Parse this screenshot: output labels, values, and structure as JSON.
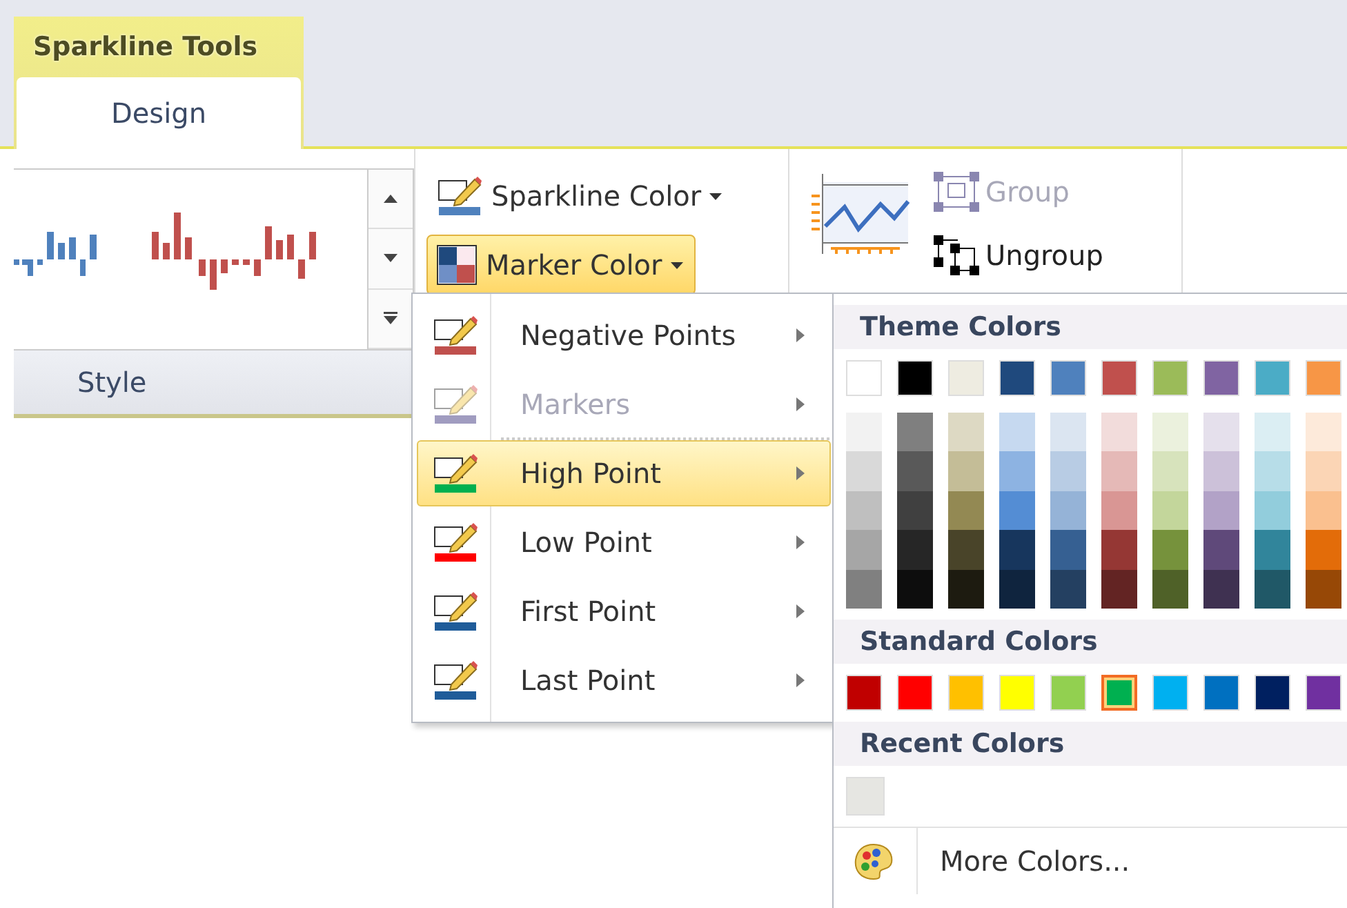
{
  "contextual_tab": {
    "title": "Sparkline Tools"
  },
  "tabs": [
    {
      "label": "Design",
      "selected": true
    }
  ],
  "ribbon": {
    "style_group": {
      "label": "Style"
    },
    "show_group": [
      {
        "label": "Sparkline Color",
        "kind": "pen",
        "color": "#4f81bd",
        "selected": false
      },
      {
        "label": "Marker Color",
        "kind": "marker",
        "color": "#c0504d",
        "selected": true
      }
    ],
    "group_buttons": [
      {
        "label": "Group",
        "kind": "group",
        "disabled": true
      },
      {
        "label": "Ungroup",
        "kind": "ungroup",
        "disabled": false
      }
    ]
  },
  "marker_menu": {
    "items": [
      {
        "label": "Negative Points",
        "color": "#c0504d",
        "disabled": false,
        "selected": false
      },
      {
        "label": "Markers",
        "color": "#a09cc0",
        "disabled": true,
        "selected": false
      },
      {
        "label": "High Point",
        "color": "#00b050",
        "disabled": false,
        "selected": true
      },
      {
        "label": "Low Point",
        "color": "#ff0000",
        "disabled": false,
        "selected": false
      },
      {
        "label": "First Point",
        "color": "#1f5c99",
        "disabled": false,
        "selected": false
      },
      {
        "label": "Last Point",
        "color": "#1f5c99",
        "disabled": false,
        "selected": false
      }
    ]
  },
  "color_panel": {
    "theme_title": "Theme Colors",
    "theme_colors": [
      {
        "color": "#ffffff",
        "shades": [
          {
            "color": "#f2f2f2"
          },
          {
            "color": "#d9d9d9"
          },
          {
            "color": "#bfbfbf"
          },
          {
            "color": "#a6a6a6"
          },
          {
            "color": "#808080"
          }
        ]
      },
      {
        "color": "#000000",
        "shades": [
          {
            "color": "#7f7f7f"
          },
          {
            "color": "#595959"
          },
          {
            "color": "#404040"
          },
          {
            "color": "#262626"
          },
          {
            "color": "#0d0d0d"
          }
        ]
      },
      {
        "color": "#eeece1",
        "shades": [
          {
            "color": "#ddd9c3"
          },
          {
            "color": "#c4bd97"
          },
          {
            "color": "#938953"
          },
          {
            "color": "#494429"
          },
          {
            "color": "#1d1b10"
          }
        ]
      },
      {
        "color": "#1f497d",
        "shades": [
          {
            "color": "#c6d9f0"
          },
          {
            "color": "#8db3e2"
          },
          {
            "color": "#548dd4"
          },
          {
            "color": "#17365d"
          },
          {
            "color": "#0f243e"
          }
        ]
      },
      {
        "color": "#4f81bd",
        "shades": [
          {
            "color": "#dbe5f1"
          },
          {
            "color": "#b8cce4"
          },
          {
            "color": "#95b3d7"
          },
          {
            "color": "#366092"
          },
          {
            "color": "#244061"
          }
        ]
      },
      {
        "color": "#c0504d",
        "shades": [
          {
            "color": "#f2dcdb"
          },
          {
            "color": "#e5b9b7"
          },
          {
            "color": "#d99694"
          },
          {
            "color": "#953734"
          },
          {
            "color": "#632423"
          }
        ]
      },
      {
        "color": "#9bbb59",
        "shades": [
          {
            "color": "#ebf1dd"
          },
          {
            "color": "#d7e3bc"
          },
          {
            "color": "#c3d69b"
          },
          {
            "color": "#76923c"
          },
          {
            "color": "#4f6128"
          }
        ]
      },
      {
        "color": "#8064a2",
        "shades": [
          {
            "color": "#e5e0ec"
          },
          {
            "color": "#ccc1d9"
          },
          {
            "color": "#b2a2c7"
          },
          {
            "color": "#5f497a"
          },
          {
            "color": "#3f3151"
          }
        ]
      },
      {
        "color": "#4bacc6",
        "shades": [
          {
            "color": "#dbeef3"
          },
          {
            "color": "#b7dde8"
          },
          {
            "color": "#92cddc"
          },
          {
            "color": "#31859b"
          },
          {
            "color": "#205867"
          }
        ]
      },
      {
        "color": "#f79646",
        "shades": [
          {
            "color": "#fdeada"
          },
          {
            "color": "#fbd5b5"
          },
          {
            "color": "#fac08f"
          },
          {
            "color": "#e36c09"
          },
          {
            "color": "#974806"
          }
        ]
      }
    ],
    "standard_title": "Standard Colors",
    "standard_colors": [
      {
        "color": "#c00000",
        "selected": false
      },
      {
        "color": "#ff0000",
        "selected": false
      },
      {
        "color": "#ffc000",
        "selected": false
      },
      {
        "color": "#ffff00",
        "selected": false
      },
      {
        "color": "#92d050",
        "selected": false
      },
      {
        "color": "#00b050",
        "selected": true
      },
      {
        "color": "#00b0f0",
        "selected": false
      },
      {
        "color": "#0070c0",
        "selected": false
      },
      {
        "color": "#002060",
        "selected": false
      },
      {
        "color": "#7030a0",
        "selected": false
      }
    ],
    "recent_title": "Recent Colors",
    "recent_colors": [
      {
        "color": "#e6e6e2"
      }
    ],
    "more_colors": {
      "label": "More Colors..."
    }
  }
}
